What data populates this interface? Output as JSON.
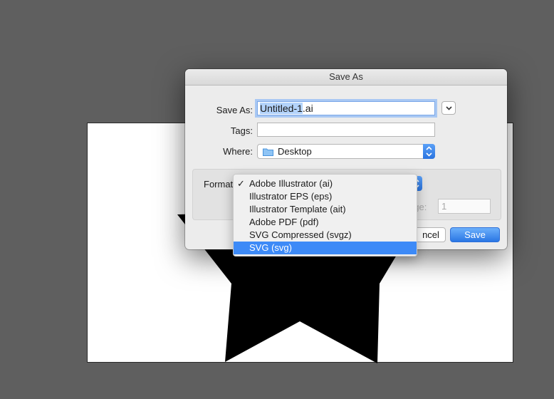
{
  "dialog": {
    "title": "Save As",
    "save_as_label": "Save As:",
    "filename_selected": "Untitled-1",
    "filename_ext": ".ai",
    "tags_label": "Tags:",
    "tags_value": "",
    "where_label": "Where:",
    "where_value": "Desktop",
    "format_label": "Format:",
    "range_label_partial": "nge:",
    "range_value": "1",
    "cancel_label_partial": "ncel",
    "save_label": "Save"
  },
  "format_menu": {
    "checked_index": 0,
    "items": [
      {
        "label": "Adobe Illustrator (ai)"
      },
      {
        "label": "Illustrator EPS (eps)"
      },
      {
        "label": "Illustrator Template (ait)"
      },
      {
        "label": "Adobe PDF (pdf)"
      },
      {
        "label": "SVG Compressed (svgz)"
      },
      {
        "label": "SVG (svg)"
      }
    ],
    "highlighted_index": 5,
    "check_glyph": "✓"
  },
  "colors": {
    "background": "#5f5f5f",
    "accent": "#3d8af7",
    "star": "#000000"
  },
  "icons": {
    "where": "folder-icon",
    "expand": "chevron-down-icon",
    "popup": "up-down-arrows-icon"
  }
}
